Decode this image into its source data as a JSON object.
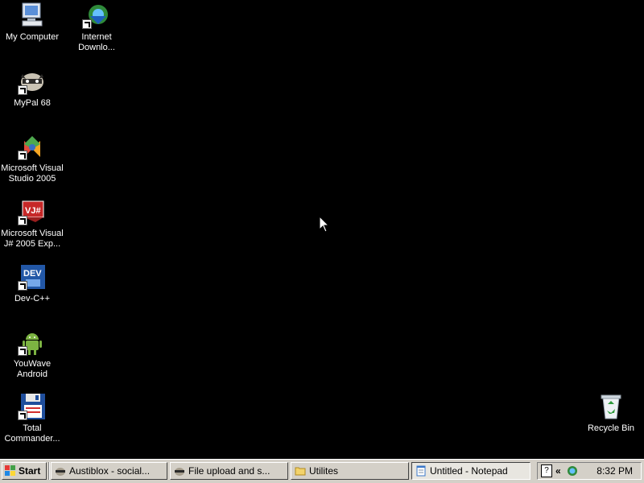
{
  "desktop": {
    "icons": [
      {
        "label": "My Computer",
        "icon": "computer-icon"
      },
      {
        "label": "Internet\nDownlo...",
        "icon": "download-manager-icon"
      },
      {
        "label": "MyPal 68",
        "icon": "mypal-icon"
      },
      {
        "label": "Microsoft Visual\nStudio 2005",
        "icon": "visual-studio-icon"
      },
      {
        "label": "Microsoft Visual\nJ# 2005 Exp...",
        "icon": "vj-icon"
      },
      {
        "label": "Dev-C++",
        "icon": "devcpp-icon"
      },
      {
        "label": "YouWave\nAndroid",
        "icon": "android-icon"
      },
      {
        "label": "Total\nCommander...",
        "icon": "floppy-icon"
      },
      {
        "label": "Recycle Bin",
        "icon": "recycle-bin-icon"
      }
    ]
  },
  "taskbar": {
    "start_label": "Start",
    "tasks": [
      {
        "label": "Austiblox - social..."
      },
      {
        "label": "File upload and s..."
      },
      {
        "label": "Utilites"
      },
      {
        "label": "Untitled - Notepad"
      }
    ],
    "tray": {
      "help": "?",
      "chevron": "«",
      "clock": "8:32 PM"
    }
  }
}
